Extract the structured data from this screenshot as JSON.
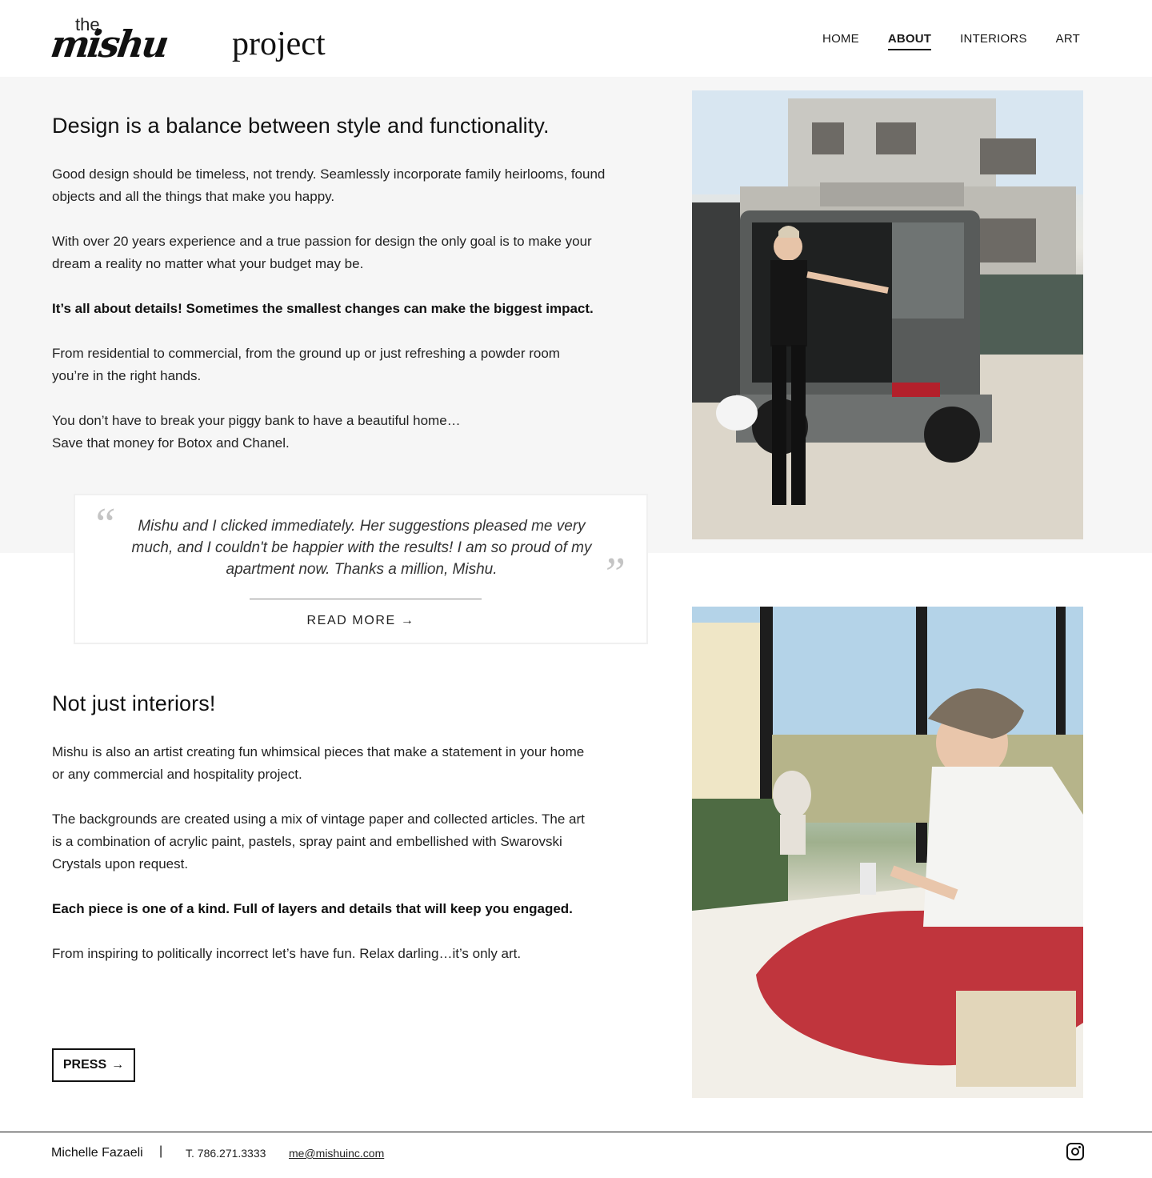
{
  "brand": {
    "the": "the",
    "script": "mishu",
    "project": "project"
  },
  "nav": {
    "items": [
      "HOME",
      "ABOUT",
      "INTERIORS",
      "ART"
    ],
    "active": "ABOUT"
  },
  "design_section": {
    "heading": "Design is a balance between style and functionality.",
    "p1": "Good design should be timeless, not trendy. Seamlessly incorporate family heirlooms, found objects and all the things that make you happy.",
    "p2": "With over 20 years experience and a true passion for design the only goal is to make your dream a reality no matter what your budget may be.",
    "p3": "It’s all about details! Sometimes the smallest changes can make the biggest impact.",
    "p4": "From residential to commercial, from the ground up or just refreshing a powder room you’re in the right hands.",
    "p5a": "You don’t have to break your piggy bank to have a beautiful home…",
    "p5b": "Save that money for Botox and Chanel."
  },
  "testimonial": {
    "quote": "Mishu and I clicked immediately. Her suggestions pleased me very much, and I couldn't be happier with the results! I am so proud of my apartment now. Thanks a million, Mishu.",
    "read_more": "READ MORE"
  },
  "art_section": {
    "heading": "Not just interiors!",
    "p1": "Mishu is also an artist creating fun whimsical pieces that make a statement in your home or any commercial and hospitality project.",
    "p2": "The backgrounds are created using a mix of vintage paper and collected articles. The art is a combination of acrylic paint, pastels, spray paint and embellished with Swarovski Crystals upon request.",
    "p3": "Each piece is one of a kind. Full of layers and details that will keep you engaged.",
    "p4": "From inspiring to politically incorrect let’s have fun. Relax darling…it’s only art."
  },
  "press_button": "PRESS",
  "footer": {
    "name": "Michelle Fazaeli",
    "separator": "|",
    "phone": "T. 786.271.3333",
    "email": "me@mishuinc.com",
    "social_icon": "instagram-icon"
  }
}
